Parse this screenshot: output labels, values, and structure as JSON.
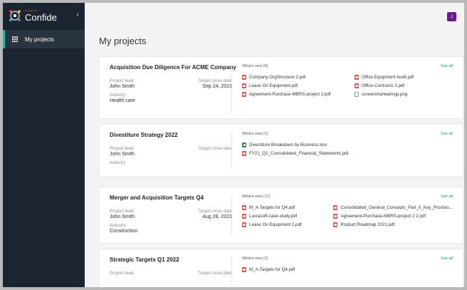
{
  "app": {
    "brand_small": "Avepoint",
    "brand_name": "Confide",
    "collapse_icon": "chevron-left-icon"
  },
  "sidebar": {
    "items": [
      {
        "label": "My projects",
        "icon": "grid-icon",
        "active": true
      }
    ]
  },
  "user": {
    "initial": "J",
    "color": "#6b1b8a"
  },
  "page": {
    "title": "My projects"
  },
  "colors": {
    "accent": "#2bb3a6",
    "link": "#1a8f83",
    "sidebar_bg": "#1b2430"
  },
  "projects": [
    {
      "name": "Acquisition Due Diligence For ACME Company",
      "lead_label": "Project lead",
      "lead": "John Smith",
      "close_label": "Target close date",
      "close": "Sep 24, 2021",
      "industry_label": "Industry",
      "industry": "Health care",
      "whats_new": "What's new (6)",
      "see_all": "See all",
      "files": [
        {
          "name": "Company-OrgStructure 2.pdf",
          "type": "pdf"
        },
        {
          "name": "Office Equipment Audit.pdf",
          "type": "pdf"
        },
        {
          "name": "Lease On Equipment.pdf",
          "type": "pdf"
        },
        {
          "name": "Office-Contracts 2.pdf",
          "type": "pdf"
        },
        {
          "name": "Agreement-Purchase-MBRS-project 2.pdf",
          "type": "pdf"
        },
        {
          "name": "screensharteamsjp.png",
          "type": "png"
        }
      ]
    },
    {
      "name": "Divestiture Strategy 2022",
      "lead_label": "Project lead",
      "lead": "John Smith",
      "close_label": "Target close date",
      "close": "",
      "industry_label": "Industry",
      "industry": "",
      "whats_new": "What's new (2)",
      "see_all": "See all",
      "files": [
        {
          "name": "Divestiture Breakdown by Business.xlsx",
          "type": "xlsx"
        },
        {
          "name": "FY21_Q2_Consolidated_Financial_Statements.pdf",
          "type": "pdf"
        }
      ]
    },
    {
      "name": "Merger and Acquisition Targets Q4",
      "lead_label": "Project lead",
      "lead": "John Smith",
      "close_label": "Target close date",
      "close": "Aug 28, 2021",
      "industry_label": "Industry",
      "industry": "Construction",
      "whats_new": "What's new (17)",
      "see_all": "See all",
      "files": [
        {
          "name": "M_A-Targets for Q4.pdf",
          "type": "pdf"
        },
        {
          "name": "Consolidated_General_Concepts_Part_II_Key_Provisio...",
          "type": "pdf"
        },
        {
          "name": "Lucrasoft-case-study.pdf",
          "type": "pdf"
        },
        {
          "name": "Agreement-Purchase-MBRS-project 2 2.pdf",
          "type": "pdf"
        },
        {
          "name": "Lease On Equipment 2.pdf",
          "type": "pdf"
        },
        {
          "name": "Product Roadmap 2021.pdf",
          "type": "pdf"
        }
      ]
    },
    {
      "name": "Strategic Targets Q1 2022",
      "lead_label": "Project lead",
      "lead": "",
      "close_label": "Target close date",
      "close": "",
      "industry_label": "Industry",
      "industry": "",
      "whats_new": "What's new (1)",
      "see_all": "See all",
      "files": [
        {
          "name": "M_A-Targets for Q4.pdf",
          "type": "pdf"
        }
      ]
    }
  ]
}
